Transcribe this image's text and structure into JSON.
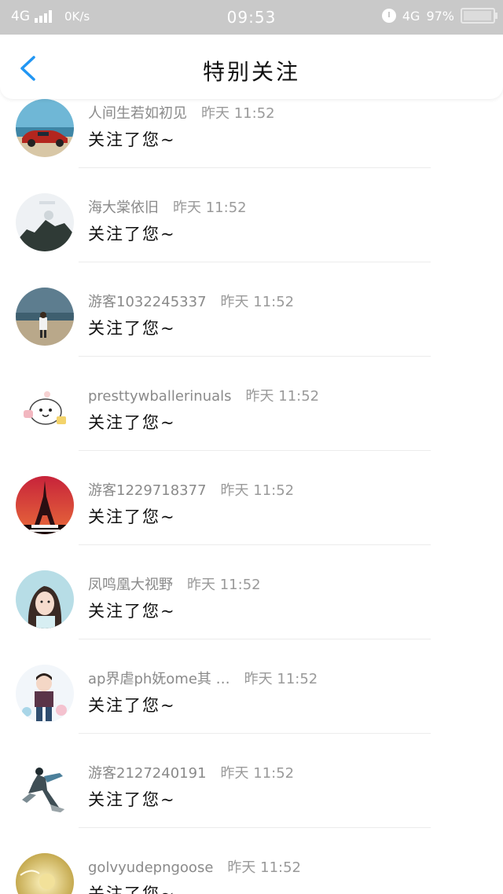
{
  "status_bar": {
    "network": "4G",
    "speed": "0K/s",
    "time": "09:53",
    "network_right": "4G",
    "battery": "97%",
    "battery_level": 0.97
  },
  "nav": {
    "title": "特别关注",
    "back_icon": "chevron-left-icon",
    "back_color": "#2196f3"
  },
  "items": [
    {
      "name": "人间生若如初见",
      "time": "昨天 11:52",
      "message": "关注了您~",
      "avatar": "car-on-beach"
    },
    {
      "name": "海大棠依旧",
      "time": "昨天 11:52",
      "message": "关注了您~",
      "avatar": "mountain-sky"
    },
    {
      "name": "游客1032245337",
      "time": "昨天 11:52",
      "message": "关注了您~",
      "avatar": "person-at-sea"
    },
    {
      "name": "presttywballerinuals",
      "time": "昨天 11:52",
      "message": "关注了您~",
      "avatar": "cartoon-bun"
    },
    {
      "name": "游客1229718377",
      "time": "昨天 11:52",
      "message": "关注了您~",
      "avatar": "eiffel-tower-sunset"
    },
    {
      "name": "凤鸣凰大视野",
      "time": "昨天 11:52",
      "message": "关注了您~",
      "avatar": "girl-portrait"
    },
    {
      "name": "ap界虐ph妩ome其 …",
      "time": "昨天 11:52",
      "message": "关注了您~",
      "avatar": "boy-cartoon"
    },
    {
      "name": "游客2127240191",
      "time": "昨天 11:52",
      "message": "关注了您~",
      "avatar": "dancer-figure"
    },
    {
      "name": "golvyudepngoose",
      "time": "昨天 11:52",
      "message": "关注了您~",
      "avatar": "golden-flower"
    }
  ]
}
